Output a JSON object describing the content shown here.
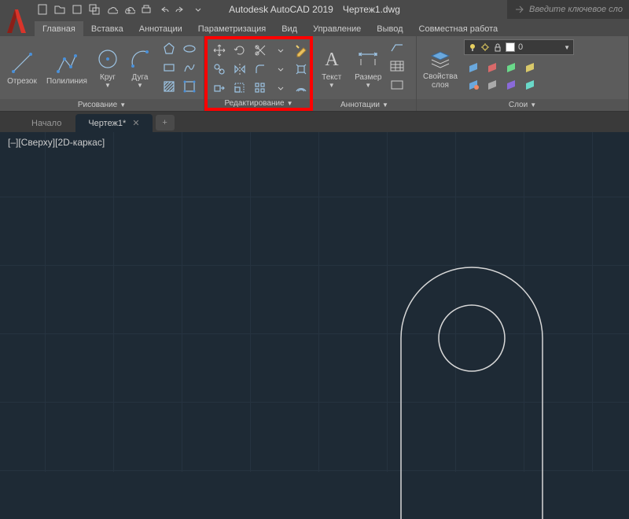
{
  "app": {
    "name": "Autodesk AutoCAD 2019",
    "document": "Чертеж1.dwg"
  },
  "search": {
    "placeholder": "Введите ключевое сло"
  },
  "tabs": [
    {
      "label": "Главная",
      "active": true
    },
    {
      "label": "Вставка"
    },
    {
      "label": "Аннотации"
    },
    {
      "label": "Параметризация"
    },
    {
      "label": "Вид"
    },
    {
      "label": "Управление"
    },
    {
      "label": "Вывод"
    },
    {
      "label": "Совместная работа"
    }
  ],
  "panels": {
    "drawing": {
      "title": "Рисование",
      "tools": {
        "line": "Отрезок",
        "polyline": "Полилиния",
        "circle": "Круг",
        "arc": "Дуга"
      }
    },
    "modify": {
      "title": "Редактирование"
    },
    "annotation": {
      "title": "Аннотации",
      "tools": {
        "text": "Текст",
        "dimension": "Размер"
      }
    },
    "layers": {
      "title": "Слои",
      "props_label": "Свойства\nслоя",
      "current": "0"
    }
  },
  "doc_tabs": [
    {
      "label": "Начало",
      "active": false
    },
    {
      "label": "Чертеж1*",
      "active": true
    }
  ],
  "viewport": {
    "label": "[–][Сверху][2D-каркас]"
  }
}
